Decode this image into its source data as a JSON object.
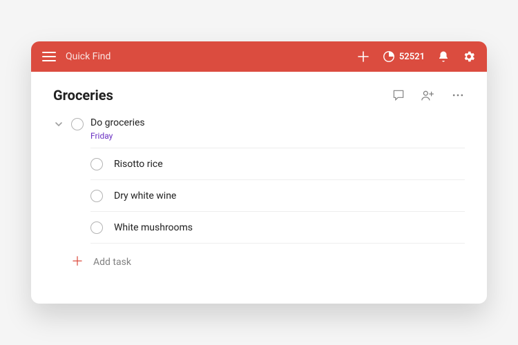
{
  "topbar": {
    "search_placeholder": "Quick Find",
    "karma_count": "52521"
  },
  "list": {
    "title": "Groceries",
    "parent_task": {
      "title": "Do groceries",
      "due": "Friday"
    },
    "subtasks": [
      {
        "title": "Risotto rice"
      },
      {
        "title": "Dry white wine"
      },
      {
        "title": "White mushrooms"
      }
    ],
    "add_task_label": "Add task"
  }
}
